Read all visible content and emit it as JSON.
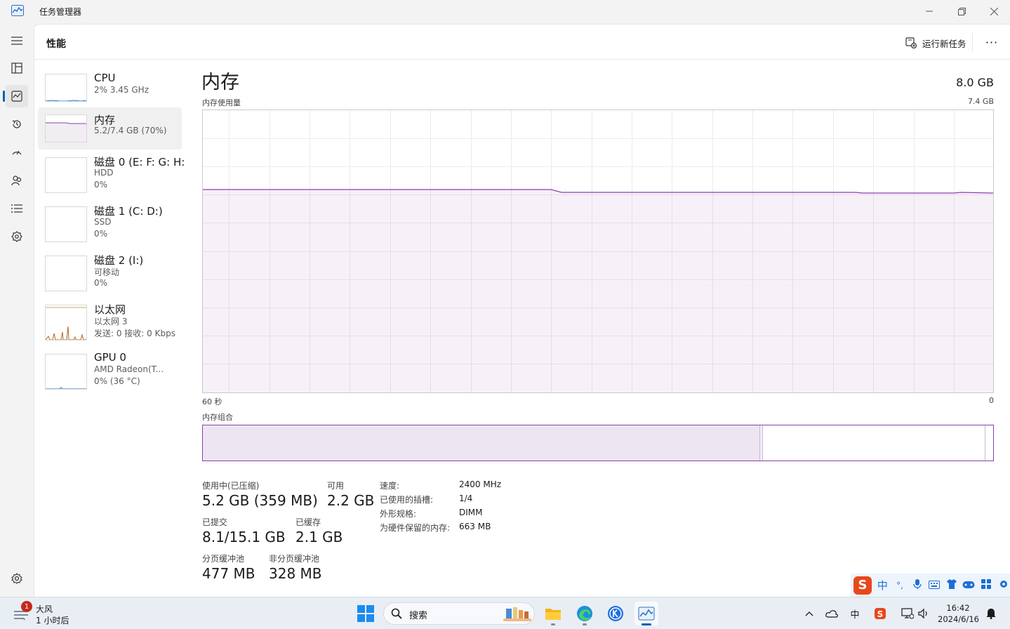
{
  "window": {
    "title": "任务管理器"
  },
  "header": {
    "title": "性能",
    "run_new_task": "运行新任务",
    "more": "···"
  },
  "resources": [
    {
      "name": "CPU",
      "sub1": "2%  3.45 GHz",
      "sub2": ""
    },
    {
      "name": "内存",
      "sub1": "5.2/7.4 GB (70%)",
      "sub2": ""
    },
    {
      "name": "磁盘 0 (E: F: G: H:",
      "sub1": "HDD",
      "sub2": "0%"
    },
    {
      "name": "磁盘 1 (C: D:)",
      "sub1": "SSD",
      "sub2": "0%"
    },
    {
      "name": "磁盘 2 (I:)",
      "sub1": "可移动",
      "sub2": "0%"
    },
    {
      "name": "以太网",
      "sub1": "以太网 3",
      "sub2": "发送: 0 接收: 0 Kbps"
    },
    {
      "name": "GPU 0",
      "sub1": "AMD Radeon(T...",
      "sub2": "0% (36 °C)"
    }
  ],
  "memory": {
    "title": "内存",
    "total": "8.0 GB",
    "usage_label": "内存使用量",
    "usage_max": "7.4 GB",
    "time_left": "60 秒",
    "time_right": "0",
    "composition_label": "内存组合",
    "usage_fraction": 0.7,
    "stats": {
      "in_use_label": "使用中(已压缩)",
      "in_use_value": "5.2 GB (359 MB)",
      "available_label": "可用",
      "available_value": "2.2 GB",
      "committed_label": "已提交",
      "committed_value": "8.1/15.1 GB",
      "cached_label": "已缓存",
      "cached_value": "2.1 GB",
      "paged_label": "分页缓冲池",
      "paged_value": "477 MB",
      "nonpaged_label": "非分页缓冲池",
      "nonpaged_value": "328 MB"
    },
    "specs": {
      "speed_label": "速度:",
      "speed_value": "2400 MHz",
      "slots_label": "已使用的插槽:",
      "slots_value": "1/4",
      "form_label": "外形规格:",
      "form_value": "DIMM",
      "reserved_label": "为硬件保留的内存:",
      "reserved_value": "663 MB"
    }
  },
  "ime": {
    "logo": "S",
    "lang": "中",
    "punct": "°,"
  },
  "taskbar": {
    "weather_badge": "1",
    "weather_title": "大风",
    "weather_sub": "1 小时后",
    "search_placeholder": "搜索",
    "tray_lang": "中",
    "time": "16:42",
    "date": "2024/6/16"
  },
  "colors": {
    "memory_accent": "#8b3fae",
    "memory_fill": "#f1edf3",
    "composition_inuse": "#ede5f1",
    "nav_accent": "#005fb8"
  }
}
